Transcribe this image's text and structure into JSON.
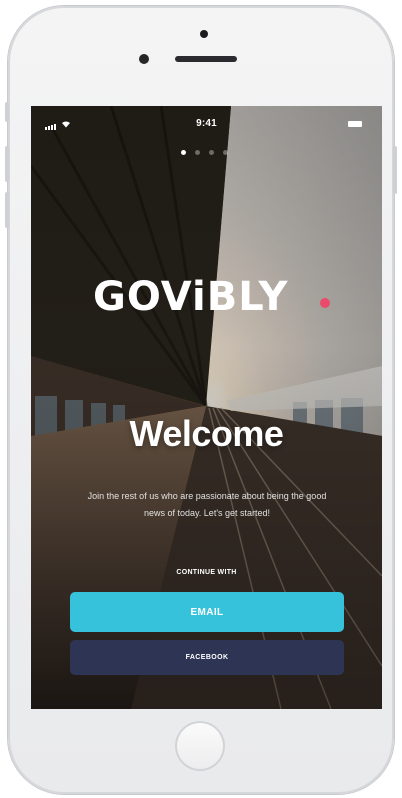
{
  "status_bar": {
    "time": "9:41"
  },
  "onboarding": {
    "page_count": 4,
    "active_page": 1,
    "logo_text": "GOViBLY",
    "welcome_title": "Welcome",
    "tagline": "Join the rest of us who are passionate about being the good news of today. Let's get started!",
    "continue_label": "CONTINUE WITH",
    "email_button_label": "EMAIL",
    "facebook_button_label": "FACEBOOK"
  },
  "colors": {
    "email_button": "#37c2dc",
    "facebook_button": "#2e3453",
    "logo_dot": "#e94b6a"
  }
}
